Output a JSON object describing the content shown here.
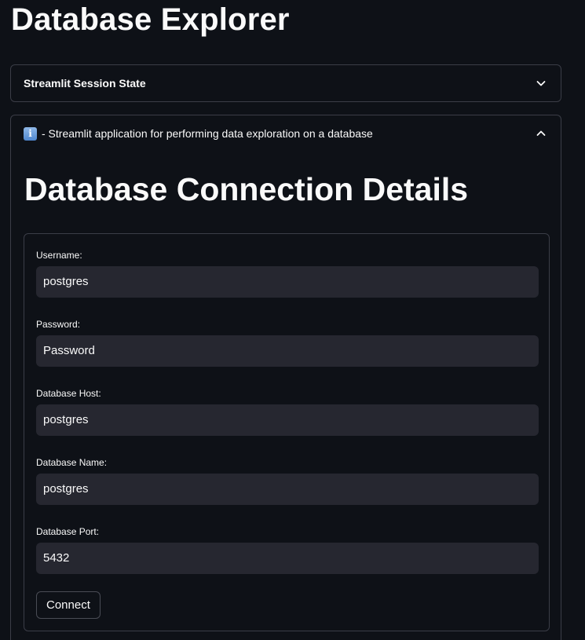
{
  "app": {
    "title": "Database Explorer"
  },
  "expanders": {
    "session_state": {
      "label": "Streamlit Session State",
      "expanded": false
    },
    "info": {
      "icon": "info-icon",
      "icon_glyph": "i",
      "label": "- Streamlit application for performing data exploration on a database",
      "expanded": true
    }
  },
  "connection": {
    "heading": "Database Connection Details",
    "fields": [
      {
        "label": "Username:",
        "value": "postgres",
        "placeholder": ""
      },
      {
        "label": "Password:",
        "value": "",
        "placeholder": "Password"
      },
      {
        "label": "Database Host:",
        "value": "postgres",
        "placeholder": ""
      },
      {
        "label": "Database Name:",
        "value": "postgres",
        "placeholder": ""
      },
      {
        "label": "Database Port:",
        "value": "5432",
        "placeholder": ""
      }
    ],
    "submit_label": "Connect"
  },
  "colors": {
    "background": "#0e1117",
    "input_background": "#262730",
    "border": "#3b3d47",
    "text": "#fafafa"
  }
}
